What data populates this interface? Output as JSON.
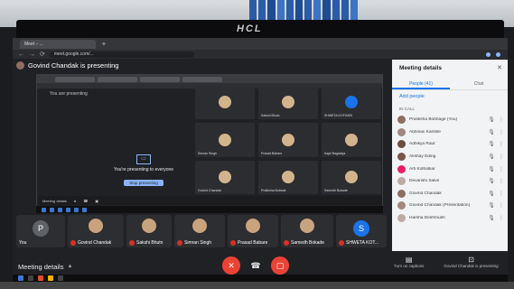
{
  "brand": "HCL",
  "browser": {
    "tabs": [
      "Meet – ...",
      "+"
    ],
    "url": "meet.google.com/..."
  },
  "presenting_banner": "Govind Chandak is presenting",
  "shared_screen": {
    "banner": "You are presenting",
    "present_message": "You're presenting to everyone",
    "stop_label": "Stop presenting",
    "inner_tiles": [
      "",
      "Sakshi Bhutn",
      "SHWETA KOTHARI",
      "Simran Singh",
      "Prasad Babare",
      "Kajal Bagadiya",
      "Govind Chandak",
      "Pratiksha Bobade",
      "Samedh Bokade"
    ],
    "inner_toolbar_left": "Meeting details"
  },
  "filmstrip": [
    {
      "name": "You",
      "avatar": "P",
      "avatar_color": "#5f6368",
      "muted": false
    },
    {
      "name": "Govind Chandak",
      "avatar": "",
      "avatar_color": "",
      "muted": true
    },
    {
      "name": "Sakshi Bhutn",
      "avatar": "",
      "avatar_color": "",
      "muted": true
    },
    {
      "name": "Simran Singh",
      "avatar": "",
      "avatar_color": "",
      "muted": true
    },
    {
      "name": "Prasad Babare",
      "avatar": "",
      "avatar_color": "",
      "muted": true
    },
    {
      "name": "Samedh Bokade",
      "avatar": "",
      "avatar_color": "",
      "muted": true
    },
    {
      "name": "SHWETA KOT...",
      "avatar": "S",
      "avatar_color": "#1a73e8",
      "muted": true
    }
  ],
  "controls": {
    "meeting_details": "Meeting details",
    "turn_on_captions": "Turn on captions",
    "presenting_label": "Govind Chandak is presenting"
  },
  "panel": {
    "title": "Meeting details",
    "tab_people": "People (41)",
    "tab_chat": "Chat",
    "add_people": "Add people",
    "in_call": "IN CALL",
    "people": [
      {
        "name": "Pratiksha Bobhage (You)",
        "avatar_color": "#8d6e63"
      },
      {
        "name": "Abhinav Kamble",
        "avatar_color": "#a1887f"
      },
      {
        "name": "Adhikya Raut",
        "avatar_color": "#6d4c41"
      },
      {
        "name": "Akshay Eding",
        "avatar_color": "#795548"
      },
      {
        "name": "Arti Kolhatkar",
        "avatar_color": "#e91e63"
      },
      {
        "name": "Devanshi Salve",
        "avatar_color": "#bcaaa4"
      },
      {
        "name": "Govind Chandak",
        "avatar_color": "#8d6e63"
      },
      {
        "name": "Govind Chandak (Presentation)",
        "avatar_color": "#a1887f"
      },
      {
        "name": "Harsha Deshmukh",
        "avatar_color": "#bcaaa4"
      }
    ]
  }
}
